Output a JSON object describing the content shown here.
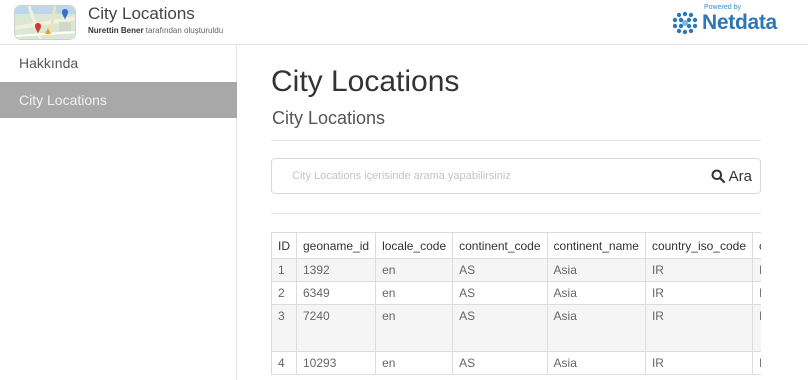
{
  "app": {
    "title": "City Locations",
    "author": "Nurettin Bener",
    "author_suffix": " tarafından oluşturuldu"
  },
  "brand": {
    "powered": "Powered by",
    "name": "Netdata",
    "color": "#2b77b8"
  },
  "sidebar": {
    "items": [
      {
        "label": "Hakkında",
        "active": false
      },
      {
        "label": "City Locations",
        "active": true
      }
    ]
  },
  "main": {
    "title": "City Locations",
    "subtitle": "City Locations",
    "search": {
      "placeholder": "City Locations içerisinde arama yapabilirsiniz",
      "button_label": "Ara"
    },
    "table": {
      "columns": [
        "ID",
        "geoname_id",
        "locale_code",
        "continent_code",
        "continent_name",
        "country_iso_code",
        "c"
      ],
      "rows": [
        [
          "1",
          "1392",
          "en",
          "AS",
          "Asia",
          "IR",
          "I"
        ],
        [
          "2",
          "6349",
          "en",
          "AS",
          "Asia",
          "IR",
          "I"
        ],
        [
          "3",
          "7240",
          "en",
          "AS",
          "Asia",
          "IR",
          "I"
        ],
        [
          "4",
          "10293",
          "en",
          "AS",
          "Asia",
          "IR",
          "I"
        ]
      ]
    }
  }
}
